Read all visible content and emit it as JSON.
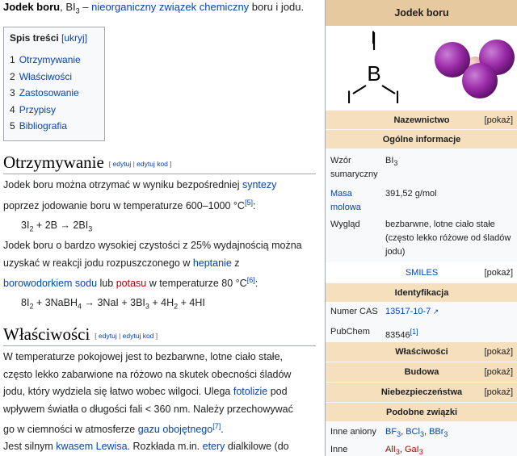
{
  "lead": {
    "title_bold": "Jodek boru",
    "formula_prefix": "BI",
    "formula_sub": "3",
    "dash": " – ",
    "link1": "nieorganiczny związek chemiczny",
    "text1": " boru i jodu."
  },
  "toc": {
    "title": "Spis treści",
    "toggle": "[ukryj]",
    "items": [
      {
        "num": "1",
        "label": "Otrzymywanie"
      },
      {
        "num": "2",
        "label": "Właściwości"
      },
      {
        "num": "3",
        "label": "Zastosowanie"
      },
      {
        "num": "4",
        "label": "Przypisy"
      },
      {
        "num": "5",
        "label": "Bibliografia"
      }
    ]
  },
  "sections": {
    "s1": {
      "title": "Otrzymywanie",
      "edit1": "edytuj",
      "sep": " | ",
      "edit2": "edytuj kod"
    },
    "s2": {
      "title": "Właściwości",
      "edit1": "edytuj",
      "sep": " | ",
      "edit2": "edytuj kod"
    }
  },
  "p1": {
    "t1": "Jodek boru można otrzymać w wyniku bezpośredniej ",
    "link_syntezy": "syntezy",
    "t2": "poprzez jodowanie boru w temperaturze 600–1000 °C",
    "ref": "[5]",
    "t3": ":"
  },
  "f1": {
    "a": "3I",
    "a_sub": "2",
    "b": " + 2B → 2BI",
    "b_sub": "3"
  },
  "p2": {
    "t1": "Jodek boru o bardzo wysokiej czystości z 25% wydajnością można",
    "t2": "uzyskać w reakcji jodu rozpuszczonego w ",
    "link_heptanie": "heptanie",
    "t3": " z",
    "link_boro": "borowodorkiem sodu",
    "t4": " lub ",
    "link_potasu": "potasu",
    "t5": " w temperaturze 80 °C",
    "ref": "[6]",
    "t6": ":"
  },
  "f2": {
    "a": "8I",
    "a_sub": "2",
    "b": " + 3NaBH",
    "b_sub": "4",
    "c": " → 3NaI + 3BI",
    "c_sub": "3",
    "d": " + 4H",
    "d_sub": "2",
    "e": " + 4HI"
  },
  "p3": {
    "t1": "W temperaturze pokojowej jest to bezbarwne, lotne ciało stałe,",
    "t2": "często lekko zabarwione na różowo na skutek obecności śladów",
    "t3": "jodu, który wydziela się łatwo wobec wilgoci. Ulega ",
    "link_fotolizie": "fotolizie",
    "t4": " pod",
    "t5": "wpływem światła o długości fali < 360 nm. Należy przechowywać",
    "t6": "go w ciemności w atmosferze ",
    "link_gazu": "gazu obojętnego",
    "ref": "[7]",
    "t7": "."
  },
  "p4": {
    "t1": "Jest silnym ",
    "link_kwasem": "kwasem Lewisa",
    "t2": ". Rozkłada m.in. ",
    "link_etery": "etery",
    "t3": " dialkilowe (do"
  },
  "structure": {
    "b": "B",
    "i": "I"
  },
  "infobox": {
    "title": "Jodek boru",
    "nazewnictwo": "Nazewnictwo",
    "pokaz": "[pokaż]",
    "ogolne": "Ogólne informacje",
    "wzor_label": "Wzór sumaryczny",
    "wzor_val": "BI",
    "wzor_sub": "3",
    "masa_label": "Masa molowa",
    "masa_val": "391,52 g/mol",
    "wyglad_label": "Wygląd",
    "wyglad_val": "bezbarwne, lotne ciało stałe (często lekko różowe od śladów jodu)",
    "smiles": "SMILES",
    "identyfikacja": "Identyfikacja",
    "cas_label": "Numer CAS",
    "cas_val": "13517-10-7",
    "pubchem_label": "PubChem",
    "pubchem_val": "83546",
    "pubchem_ref": "[1]",
    "wlasciwosci": "Właściwości",
    "budowa": "Budowa",
    "niebezp": "Niebezpieczeństwa",
    "podobne": "Podobne związki",
    "aniony_label": "Inne aniony",
    "aniony_a": "BF",
    "aniony_a_sub": "3",
    "aniony_b": "BCl",
    "aniony_b_sub": "3",
    "aniony_c": "BBr",
    "aniony_c_sub": "3",
    "inne_label": "Inne",
    "inne_a": "AlI",
    "inne_a_sub": "3",
    "inne_b": "GaI",
    "inne_b_sub": "3",
    "sep": ", "
  },
  "colors": {
    "link": "#0645ad",
    "redlink": "#ba0000",
    "header": "#e7c9a0",
    "section": "#f5dfbd",
    "iodine": "#9b2ba8"
  }
}
